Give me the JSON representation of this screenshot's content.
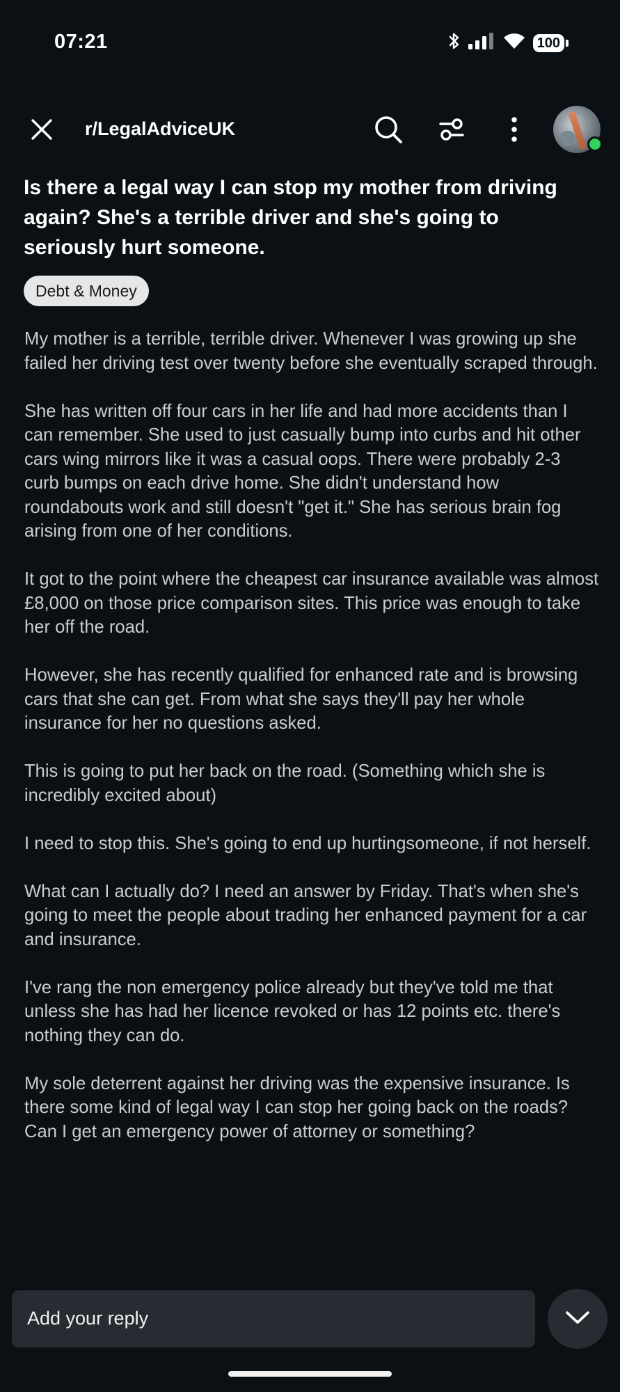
{
  "status_bar": {
    "time": "07:21",
    "battery": "100",
    "icons": [
      "bluetooth-icon",
      "signal-icon",
      "wifi-icon",
      "battery-icon"
    ]
  },
  "header": {
    "subreddit": "r/LegalAdviceUK",
    "icons": [
      "close-icon",
      "search-icon",
      "filter-icon",
      "more-vertical-icon",
      "avatar"
    ],
    "online_color": "#33d15b"
  },
  "post": {
    "title": "Is there a legal way I can stop my mother from driving again? She's a terrible driver and she's going to seriously hurt someone.",
    "flair": "Debt & Money",
    "paragraphs": [
      "My mother is a terrible, terrible driver. Whenever I was growing up she failed her driving test over twenty before she eventually scraped through.",
      "She has written off four cars in her life and had more accidents than I can remember. She used to just casually bump into curbs and hit other cars wing mirrors like it was a casual oops. There were probably 2-3 curb bumps on each drive home. She didn't understand how roundabouts work and still doesn't \"get it.\" She has serious brain fog arising from one of her conditions.",
      "It got to the point where the cheapest car insurance available was almost £8,000 on those price comparison sites. This price was enough to take her off the road.",
      "However, she has recently qualified for enhanced rate and is browsing cars that she can get. From what she says they'll pay her whole insurance for her no questions asked.",
      "This is going to put her back on the road. (Something which she is incredibly excited about)",
      "I need to stop this. She's going to end up hurtingsomeone, if not herself.",
      "What can I actually do? I need an answer by Friday. That's when she's going to meet the people about trading her enhanced payment for a car and insurance.",
      "I've rang the non emergency police already but they've told me that unless she has had her licence revoked or has 12 points etc. there's nothing they can do.",
      "My sole deterrent against her driving was the expensive insurance. Is there some kind of legal way I can stop her going back on the roads? Can I get an emergency power of attorney or something?"
    ]
  },
  "reply": {
    "placeholder": "Add your reply",
    "scroll_icon": "chevron-down-icon"
  },
  "colors": {
    "background": "#0b1014",
    "body_text": "#c8cdd1",
    "flair_bg": "#e4e6e8",
    "reply_bg": "#262c31"
  }
}
